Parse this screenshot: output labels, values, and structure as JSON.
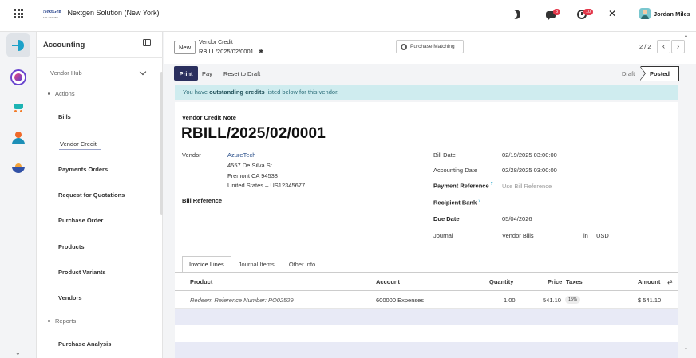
{
  "brand": {
    "logo_line1": "NextGen",
    "logo_line2": "SOLUTIONS",
    "company": "Nextgen Solution (New York)"
  },
  "topbar": {
    "chat_badge": "8",
    "activity_badge": "10",
    "user_name": "Jordan Miles"
  },
  "sidebar": {
    "title": "Accounting",
    "group": "Vendor Hub",
    "items": [
      {
        "label": "Actions"
      },
      {
        "label": "Bills"
      },
      {
        "label": "Vendor Credit"
      },
      {
        "label": "Payments Orders"
      },
      {
        "label": "Request for Quotations"
      },
      {
        "label": "Purchase Order"
      },
      {
        "label": "Products"
      },
      {
        "label": "Product Variants"
      },
      {
        "label": "Vendors"
      },
      {
        "label": "Reports"
      },
      {
        "label": "Purchase Analysis"
      }
    ]
  },
  "control": {
    "new_label": "New",
    "breadcrumb_parent": "Vendor Credit",
    "breadcrumb_current": "RBILL/2025/02/0001",
    "smart_button": "Purchase Matching",
    "pager": "2 / 2"
  },
  "actions": {
    "print": "Print",
    "pay": "Pay",
    "reset": "Reset to Draft"
  },
  "status": {
    "draft": "Draft",
    "posted": "Posted"
  },
  "alert": {
    "prefix": "You have ",
    "bold": "outstanding credits",
    "suffix": " listed below for this vendor."
  },
  "form": {
    "doc_type": "Vendor Credit Note",
    "doc_name": "RBILL/2025/02/0001",
    "vendor_label": "Vendor",
    "vendor_name": "AzureTech",
    "vendor_street": "4557 De Silva St",
    "vendor_city": "Fremont CA 94538",
    "vendor_country": "United States – US12345677",
    "bill_reference_label": "Bill Reference",
    "bill_date_label": "Bill Date",
    "bill_date": "02/19/2025 03:00:00",
    "accounting_date_label": "Accounting Date",
    "accounting_date": "02/28/2025 03:00:00",
    "payment_reference_label": "Payment Reference",
    "payment_reference_placeholder": "Use Bill Reference",
    "recipient_bank_label": "Recipient Bank",
    "due_date_label": "Due Date",
    "due_date": "05/04/2026",
    "journal_label": "Journal",
    "journal": "Vendor Bills",
    "journal_in": "in",
    "currency": "USD",
    "help_mark": "?"
  },
  "tabs": [
    "Invoice Lines",
    "Journal Items",
    "Other Info"
  ],
  "lines": {
    "headers": {
      "product": "Product",
      "account": "Account",
      "quantity": "Quantity",
      "price": "Price",
      "taxes": "Taxes",
      "amount": "Amount"
    },
    "rows": [
      {
        "product": "Redeem Reference Number: PO02529",
        "account": "600000 Expenses",
        "quantity": "1.00",
        "price": "541.10",
        "tax": "15%",
        "amount": "$ 541.10"
      }
    ]
  }
}
